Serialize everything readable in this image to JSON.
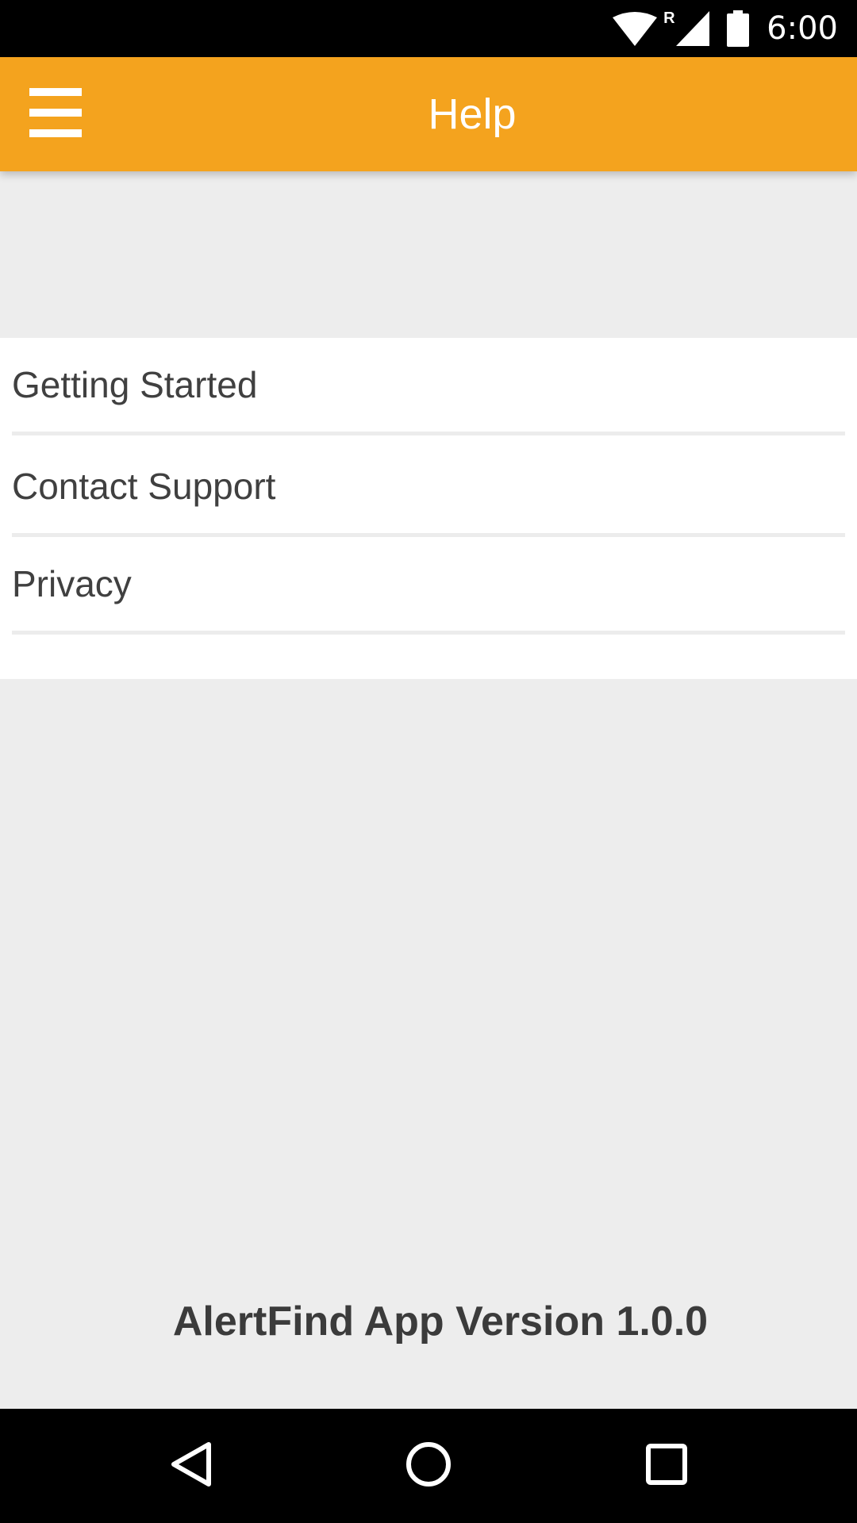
{
  "status_bar": {
    "time": "6:00",
    "icons": [
      "wifi-icon",
      "roaming-icon",
      "cell-signal-icon",
      "battery-icon"
    ],
    "roaming_indicator": "R"
  },
  "app_bar": {
    "title": "Help",
    "menu_icon": "hamburger-menu-icon",
    "color": "#f4a31e"
  },
  "help_items": [
    {
      "label": "Getting Started"
    },
    {
      "label": "Contact Support"
    },
    {
      "label": "Privacy"
    }
  ],
  "footer": {
    "version_text": "AlertFind App Version 1.0.0"
  },
  "nav_bar": {
    "icons": [
      "back-icon",
      "home-icon",
      "recents-icon"
    ]
  }
}
